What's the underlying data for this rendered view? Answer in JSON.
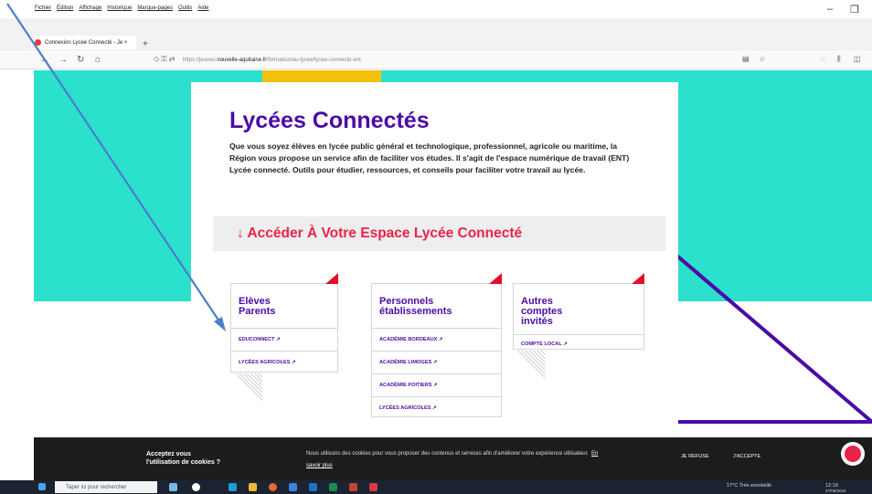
{
  "browser": {
    "menu": [
      "Fichier",
      "Édition",
      "Affichage",
      "Historique",
      "Marque-pages",
      "Outils",
      "Aide"
    ],
    "tab_title": "Connexion Lycée Connecté - Je ×",
    "url_prefix": "https://jeunes.",
    "url_host": "nouvelle-aquitaine.fr",
    "url_path": "/formation/au-lycee/lycee-connecte-ent"
  },
  "page": {
    "title": "Lycées Connectés",
    "intro": "Que vous soyez élèves en lycée public général et technologique, professionnel, agricole ou maritime, la Région vous propose un service afin de faciliter vos études. Il s'agit de l'espace numérique de travail (ENT) Lycée connecté. Outils pour étudier, ressources, et conseils pour faciliter votre travail au lycée.",
    "cta": "↓ Accéder À Votre Espace Lycée Connecté",
    "boxes": [
      {
        "title1": "Elèves",
        "title2": "Parents",
        "links": [
          "EDUCONNECT ↗",
          "LYCÉES AGRICOLES ↗"
        ]
      },
      {
        "title1": "Personnels",
        "title2": "établissements",
        "links": [
          "ACADÉMIE BORDEAUX ↗",
          "ACADÉMIE LIMOGES ↗",
          "ACADÉMIE POITIERS ↗",
          "LYCÉES AGRICOLES ↗"
        ]
      },
      {
        "title1": "Autres",
        "title2": "comptes",
        "title3": "invités",
        "links": [
          "COMPTE LOCAL ↗"
        ]
      }
    ]
  },
  "cookie": {
    "title1": "Acceptez vous",
    "title2": "l'utilisation de cookies ?",
    "text": "Nous utilisons des cookies pour vous proposer des contenus et services afin d'améliorer votre expérience utilisateur.",
    "more": "En savoir plus",
    "refuse": "JE REFUSE",
    "accept": "J'ACCEPTE"
  },
  "taskbar": {
    "search_placeholder": "Taper ici pour rechercher",
    "weather": "17°C  Très ensoleillé",
    "time": "12:19",
    "date": "27/06/2022"
  },
  "colors": {
    "teal": "#2be0cc",
    "purple": "#4b0ba6",
    "red": "#e8244a"
  }
}
